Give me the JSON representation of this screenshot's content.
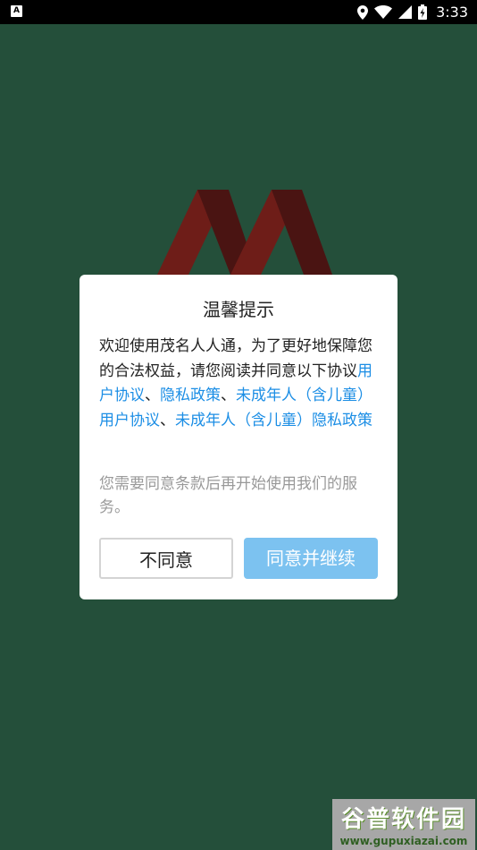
{
  "status_bar": {
    "time": "3:33",
    "app_icon_label": "A",
    "icons": [
      "location-icon",
      "wifi-icon",
      "signal-icon",
      "battery-charging-icon"
    ]
  },
  "background": {
    "color": "#244f3a",
    "logo": "app-logo-m"
  },
  "dialog": {
    "title": "温馨提示",
    "body_lead": "欢迎使用茂名人人通，为了更好地保障您的合法权益，请您阅读并同意以下协议",
    "link_1": "用户协议",
    "sep_1": "、",
    "link_2": "隐私政策",
    "sep_2": "、",
    "link_3": "未成年人（含儿童）用户协议",
    "sep_3": "、",
    "link_4": "未成年人（含儿童）隐私政策",
    "note": "您需要同意条款后再开始使用我们的服务。",
    "disagree_label": "不同意",
    "agree_label": "同意并继续",
    "link_color": "#1c8ee5",
    "agree_button_color": "#7cc2f0"
  },
  "watermark": {
    "title": "谷普软件园",
    "url": "www.gupuxiazai.com"
  }
}
